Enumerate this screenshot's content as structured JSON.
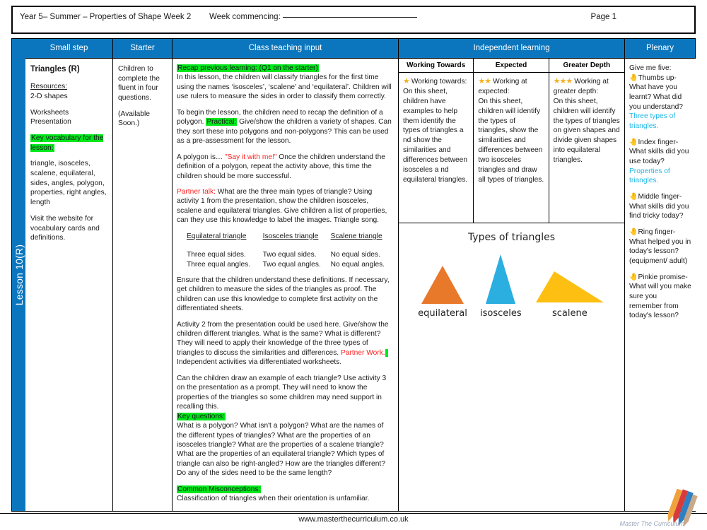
{
  "banner": {
    "title": "Year 5– Summer – Properties of Shape Week 2",
    "week_commencing_label": "Week commencing:",
    "page_label": "Page 1"
  },
  "spine": {
    "lesson_label": "Lesson 10(R)"
  },
  "columns": {
    "small_step": "Small step",
    "starter": "Starter",
    "class_teaching_input": "Class teaching input",
    "independent_learning": "Independent learning",
    "plenary": "Plenary"
  },
  "small_step": {
    "title": "Triangles (R)",
    "resources_label": "Resources:",
    "resources_items": "2-D shapes",
    "materials": "Worksheets\nPresentation",
    "key_vocab_heading": "Key vocabulary for the lesson:",
    "key_vocab_list": "triangle, isosceles, scalene, equilateral, sides, angles, polygon, properties, right angles, length",
    "website_note": "Visit the website for vocabulary cards and definitions."
  },
  "starter": {
    "line1": "Children to complete the fluent in four questions.",
    "line2": "(Available Soon.)"
  },
  "teaching": {
    "recap_heading": "Recap previous learning: (Q1 on the starter)",
    "recap_body": "In this lesson, the children will classify triangles for the first time using the names ‘isosceles’, ‘scalene’ and ‘equilateral’. Children will use rulers to measure the sides in order to classify them correctly.",
    "para2_a": "To begin the lesson, the children need to recap the definition of a polygon. ",
    "para2_practical": "Practical:",
    "para2_b": " Give/show the children a variety of shapes. Can they sort these into polygons and non-polygons? This can be used as a pre-assessment for the lesson.",
    "para3_a": "A polygon is… ",
    "para3_say": "\"Say it with me!\"",
    "para3_b": "  Once the children understand the definition of a polygon, repeat the activity above, this time the children should be more successful.",
    "partner_talk_label": "Partner talk:",
    "partner_talk_body": " What are the three main types of triangle? Using activity 1 from the presentation, show the children isosceles, scalene and equilateral triangles. Give children a list of properties, can they use this knowledge to label the images. Triangle song.",
    "triangle_table": {
      "headers": [
        "Equilateral triangle",
        "Isosceles triangle",
        "Scalene triangle"
      ],
      "rows": [
        [
          "Three equal sides.",
          "Two equal sides.",
          "No equal sides."
        ],
        [
          "Three equal angles.",
          "Two equal angles.",
          "No equal angles."
        ]
      ]
    },
    "para_ensure": "Ensure that the children understand these definitions. If necessary, get children to measure the sides of the triangles as proof. The children can use this knowledge to complete first activity on the differentiated sheets.",
    "para_activity2_a": "Activity 2 from the presentation could be used here. Give/show the children different triangles. What is the same? What is different? They will need to apply their knowledge of the three types of triangles to discuss the similarities and differences. ",
    "para_activity2_partner": "Partner Work.",
    "para_activity2_b": " Independent activities via differentiated worksheets.",
    "para_activity3": "Can the children draw an example of each triangle? Use activity 3 on the presentation as a prompt. They will need to know the properties of the triangles so some children may need support in recalling this.",
    "key_questions_heading": "Key questions:",
    "key_questions_body": "What is a polygon? What isn't a polygon? What are the names of the different types of triangles? What are the properties of an isosceles triangle? What are the properties of a scalene triangle? What are the properties of an equilateral triangle? Which types of triangle can also be right-angled? How are the triangles different? Do any of the sides need to be the same length?",
    "misconceptions_heading": "Common Misconceptions:",
    "misconceptions_body": "Classification of triangles when their orientation is unfamiliar."
  },
  "independent": {
    "tiers": [
      {
        "name": "Working Towards",
        "color": "#ED1C24",
        "stars": 1,
        "lead": "Working towards:",
        "body": "On this sheet, children have examples to help them identify the types of triangles a nd show the similarities and differences between isosceles a nd equilateral triangles."
      },
      {
        "name": "Expected",
        "color": "#FFC000",
        "stars": 2,
        "lead": "Working at expected:",
        "body": "On this sheet, children will identify the types of triangles, show the similarities and differences between two isosceles triangles and draw all types of triangles."
      },
      {
        "name": "Greater Depth",
        "color": "#00A650",
        "stars": 3,
        "lead": "Working at greater depth:",
        "body": "On this sheet, children will identify the types of triangles on given shapes and divide given shapes into equilateral triangles."
      }
    ],
    "diagram": {
      "title": "Types of triangles",
      "shapes": [
        {
          "label": "equilateral",
          "color": "#E8792B"
        },
        {
          "label": "isosceles",
          "color": "#2BAEE0"
        },
        {
          "label": "scalene",
          "color": "#FDBF11"
        }
      ]
    }
  },
  "plenary": {
    "heading": "Give me five:",
    "items": [
      {
        "icon": "hand-icon",
        "prompt": "Thumbs up- What have you learnt? What did you understand?",
        "answer": "Three types of triangles."
      },
      {
        "icon": "hand-icon",
        "prompt": "Index finger- What skills did you use today?",
        "answer": "Properties of triangles."
      },
      {
        "icon": "hand-icon",
        "prompt": "Middle finger- What skills did you find tricky today?",
        "answer": ""
      },
      {
        "icon": "hand-icon",
        "prompt": "Ring finger- What helped you in today's lesson? (equipment/ adult)",
        "answer": ""
      },
      {
        "icon": "hand-icon",
        "prompt": "Pinkie promise- What will you make sure you remember from today's lesson?",
        "answer": ""
      }
    ]
  },
  "footer": {
    "url": "www.masterthecurriculum.co.uk",
    "logo_text": "Master The Curriculum"
  }
}
